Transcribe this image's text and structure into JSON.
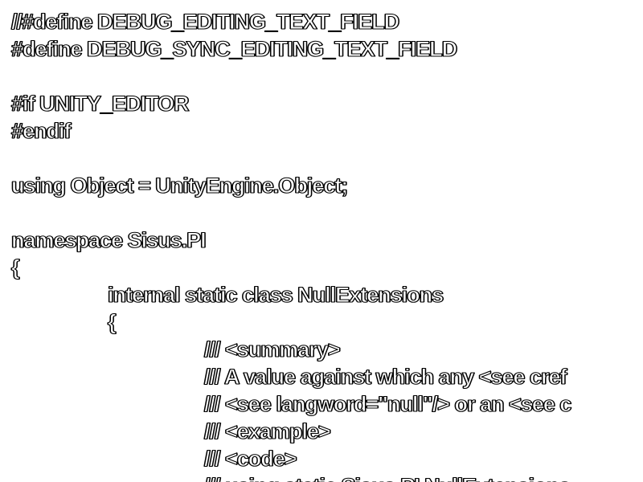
{
  "code_lines": [
    {
      "text": "//#define DEBUG_EDITING_TEXT_FIELD",
      "indent": 0
    },
    {
      "text": "#define DEBUG_SYNC_EDITING_TEXT_FIELD",
      "indent": 0
    },
    {
      "text": "",
      "indent": 0
    },
    {
      "text": "#if UNITY_EDITOR",
      "indent": 0
    },
    {
      "text": "#endif",
      "indent": 0
    },
    {
      "text": "",
      "indent": 0
    },
    {
      "text": "using Object = UnityEngine.Object;",
      "indent": 0
    },
    {
      "text": "",
      "indent": 0
    },
    {
      "text": "namespace Sisus.PI",
      "indent": 0
    },
    {
      "text": "{",
      "indent": 0
    },
    {
      "text": "internal static class NullExtensions",
      "indent": 1
    },
    {
      "text": "{",
      "indent": 1
    },
    {
      "text": "/// <summary>",
      "indent": 2
    },
    {
      "text": "/// A value against which any <see cref",
      "indent": 2
    },
    {
      "text": "/// <see langword=\"null\"/> or an <see c",
      "indent": 2
    },
    {
      "text": "/// <example>",
      "indent": 2
    },
    {
      "text": "/// <code>",
      "indent": 2
    },
    {
      "text": "/// using static Sisus.PI.NullExtensions",
      "indent": 2
    }
  ]
}
